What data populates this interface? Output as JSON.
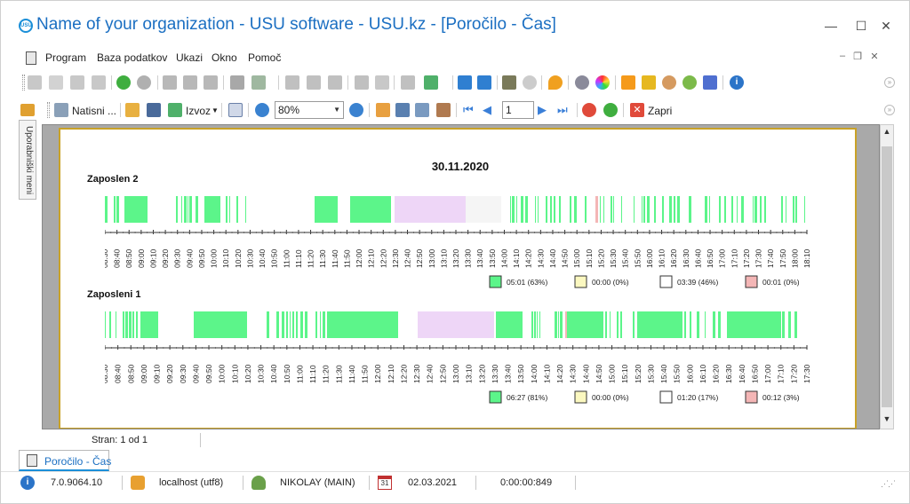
{
  "window": {
    "title": "Name of your organization - USU software - USU.kz - [Poročilo - Čas]",
    "logo_text": "USU",
    "controls": {
      "minimize": "—",
      "maximize": "☐",
      "close": "✕"
    }
  },
  "menu": {
    "items": [
      "Program",
      "Baza podatkov",
      "Ukazi",
      "Okno",
      "Pomoč"
    ],
    "mdi_controls": [
      "–",
      "❐",
      "✕"
    ]
  },
  "print_toolbar": {
    "print_label": "Natisni ...",
    "export_label": "Izvoz",
    "zoom_value": "80%",
    "page_value": "1",
    "close_label": "Zapri"
  },
  "sidebar": {
    "tab_label": "Uporabniški meni"
  },
  "report": {
    "date": "30.11.2020",
    "employees": [
      {
        "name": "Zaposlen 2",
        "ticks": [
          "08:30",
          "08:40",
          "08:50",
          "09:00",
          "09:10",
          "09:20",
          "09:30",
          "09:40",
          "09:50",
          "10:00",
          "10:10",
          "10:20",
          "10:30",
          "10:40",
          "10:50",
          "11:00",
          "11:10",
          "11:20",
          "11:30",
          "11:40",
          "11:50",
          "12:00",
          "12:10",
          "12:20",
          "12:30",
          "12:40",
          "12:50",
          "13:00",
          "13:10",
          "13:20",
          "13:30",
          "13:40",
          "13:50",
          "14:00",
          "14:10",
          "14:20",
          "14:30",
          "14:40",
          "14:50",
          "15:00",
          "15:10",
          "15:20",
          "15:30",
          "15:40",
          "15:50",
          "16:00",
          "16:10",
          "16:20",
          "16:30",
          "16:40",
          "16:50",
          "17:00",
          "17:10",
          "17:20",
          "17:30",
          "17:40",
          "17:50",
          "18:00",
          "18:10"
        ],
        "legend": [
          {
            "label": "05:01 (63%)",
            "color": "#5cf58a"
          },
          {
            "label": "00:00 (0%)",
            "color": "#fbf8c0"
          },
          {
            "label": "03:39 (46%)",
            "color": "#ffffff"
          },
          {
            "label": "00:01 (0%)",
            "color": "#f4b6b6"
          }
        ]
      },
      {
        "name": "Zaposleni 1",
        "ticks": [
          "08:30",
          "08:40",
          "08:50",
          "09:00",
          "09:10",
          "09:20",
          "09:30",
          "09:40",
          "09:50",
          "10:00",
          "10:10",
          "10:20",
          "10:30",
          "10:40",
          "10:50",
          "11:00",
          "11:10",
          "11:20",
          "11:30",
          "11:40",
          "11:50",
          "12:00",
          "12:10",
          "12:20",
          "12:30",
          "12:40",
          "12:50",
          "13:00",
          "13:10",
          "13:20",
          "13:30",
          "13:40",
          "13:50",
          "14:00",
          "14:10",
          "14:20",
          "14:30",
          "14:40",
          "14:50",
          "15:00",
          "15:10",
          "15:20",
          "15:30",
          "15:40",
          "15:50",
          "16:00",
          "16:10",
          "16:20",
          "16:30",
          "16:40",
          "16:50",
          "17:00",
          "17:10",
          "17:20",
          "17:30"
        ],
        "legend": [
          {
            "label": "06:27 (81%)",
            "color": "#5cf58a"
          },
          {
            "label": "00:00 (0%)",
            "color": "#fbf8c0"
          },
          {
            "label": "01:20 (17%)",
            "color": "#ffffff"
          },
          {
            "label": "00:12 (3%)",
            "color": "#f4b6b6"
          }
        ]
      }
    ],
    "colors": {
      "active": "#5cf58a",
      "break": "#eed6f7",
      "idle": "#f5f5f5",
      "warn": "#f4b6b6"
    }
  },
  "pager": {
    "status": "Stran: 1 od 1"
  },
  "doc_tab": {
    "label": "Poročilo - Čas"
  },
  "status": {
    "version": "7.0.9064.10",
    "database": "localhost (utf8)",
    "user": "NIKOLAY (MAIN)",
    "date": "02.03.2021",
    "elapsed": "0:00:00:849"
  }
}
